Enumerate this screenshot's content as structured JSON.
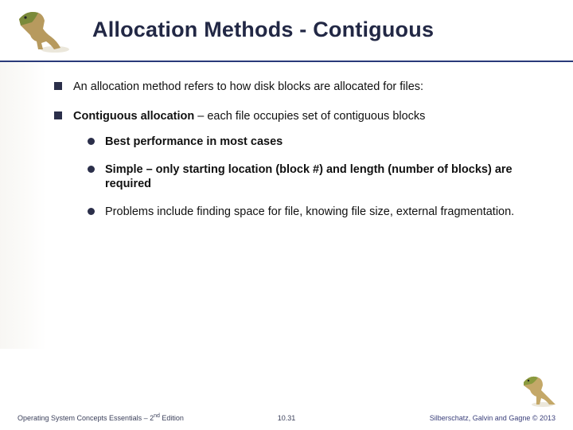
{
  "title": "Allocation Methods - Contiguous",
  "bullets": {
    "b1": "An allocation method refers to how disk blocks are allocated for files:",
    "b2_lead": "Contiguous allocation",
    "b2_rest": " – each file occupies set of contiguous blocks",
    "sub": [
      "Best performance in most cases",
      "Simple – only starting location (block #) and length (number of blocks) are required",
      "Problems include finding space for file, knowing file size, external fragmentation."
    ]
  },
  "footer": {
    "left_pre": "Operating System Concepts Essentials – 2",
    "left_sup": "nd",
    "left_post": " Edition",
    "center": "10.31",
    "right": "Silberschatz, Galvin and Gagne © 2013"
  }
}
